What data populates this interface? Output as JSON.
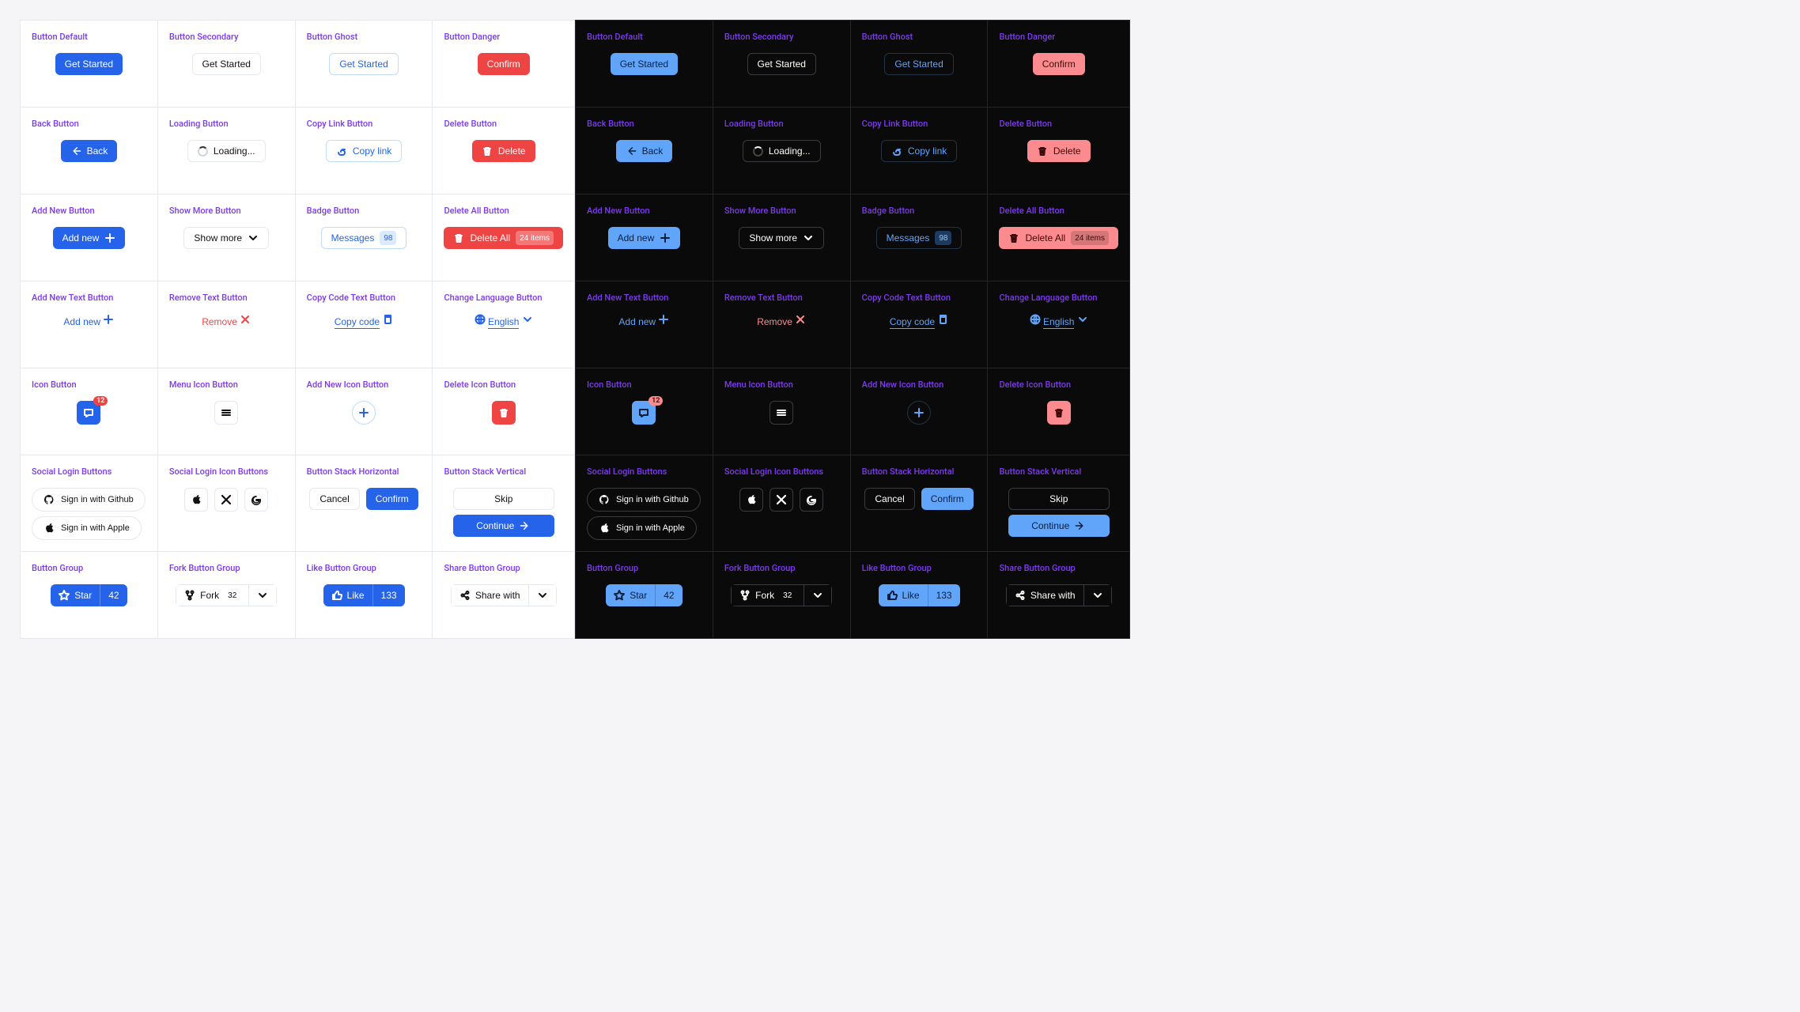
{
  "titles": {
    "default": "Button Default",
    "secondary": "Button Secondary",
    "ghost": "Button Ghost",
    "danger": "Button Danger",
    "back": "Back Button",
    "loading": "Loading Button",
    "copylink": "Copy Link Button",
    "delete": "Delete Button",
    "addnew": "Add New Button",
    "showmore": "Show More Button",
    "badge": "Badge Button",
    "deleteall": "Delete All Button",
    "addnewt": "Add New Text Button",
    "removet": "Remove Text Button",
    "copycodet": "Copy Code Text Button",
    "langt": "Change Language Button",
    "iconb": "Icon Button",
    "menuicon": "Menu Icon Button",
    "addicon": "Add New Icon Button",
    "delicon": "Delete Icon Button",
    "social": "Social Login Buttons",
    "socialicon": "Social Login Icon Buttons",
    "stackh": "Button Stack Horizontal",
    "stackv": "Button Stack Vertical",
    "bgroup": "Button Group",
    "fork": "Fork Button Group",
    "like": "Like Button Group",
    "share": "Share Button Group"
  },
  "labels": {
    "get_started": "Get Started",
    "confirm": "Confirm",
    "back": "Back",
    "loading": "Loading...",
    "copylink": "Copy link",
    "delete": "Delete",
    "addnew": "Add new",
    "showmore": "Show more",
    "messages": "Messages",
    "messages_count": "98",
    "deleteall": "Delete All",
    "deleteall_count": "24 items",
    "remove": "Remove",
    "copycode": "Copy code",
    "english": "English",
    "notif": "12",
    "github": "Sign in with Github",
    "apple": "Sign in with Apple",
    "cancel": "Cancel",
    "skip": "Skip",
    "continue": "Continue",
    "star": "Star",
    "star_count": "42",
    "fork": "Fork",
    "fork_count": "32",
    "like": "Like",
    "like_count": "133",
    "share": "Share with"
  }
}
